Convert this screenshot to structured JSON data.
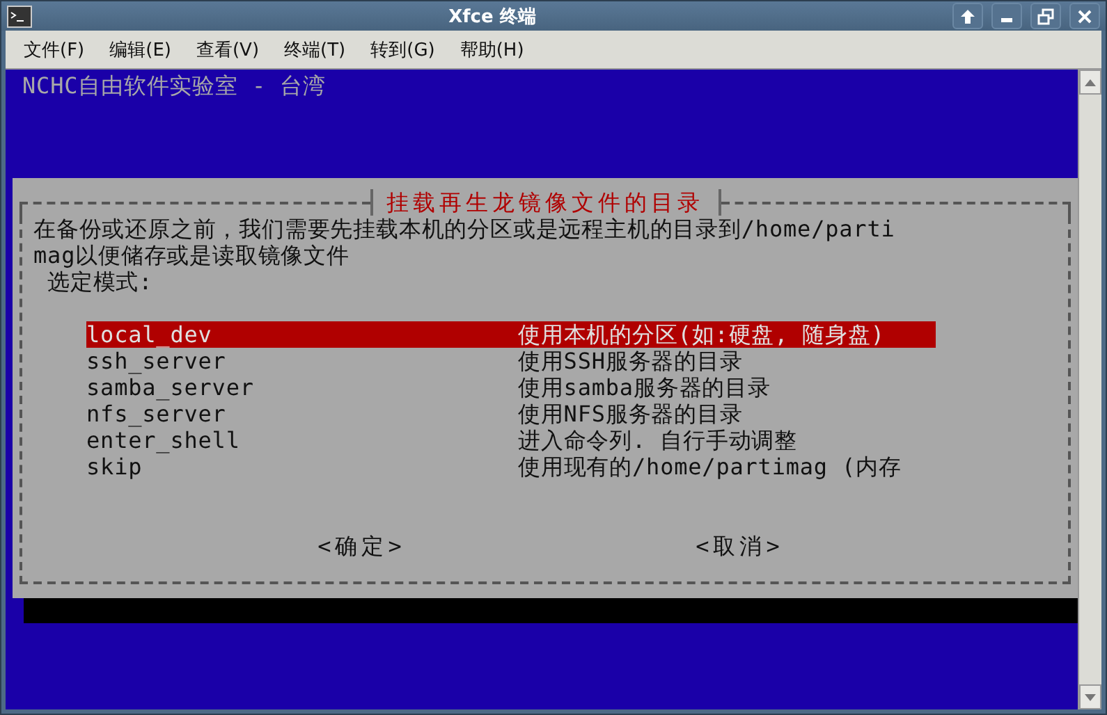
{
  "window": {
    "title": "Xfce 终端"
  },
  "menu": [
    "文件(F)",
    "编辑(E)",
    "查看(V)",
    "终端(T)",
    "转到(G)",
    "帮助(H)"
  ],
  "terminal": {
    "header": "NCHC自由软件实验室 - 台湾"
  },
  "dialog": {
    "title": "挂载再生龙镜像文件的目录",
    "message_lines": [
      "在备份或还原之前，我们需要先挂载本机的分区或是远程主机的目录到/home/parti",
      "mag以便储存或是读取镜像文件"
    ],
    "prompt": "选定模式:",
    "items": [
      {
        "tag": "local_dev",
        "description": "使用本机的分区(如:硬盘, 随身盘)",
        "selected": true
      },
      {
        "tag": "ssh_server",
        "description": "使用SSH服务器的目录",
        "selected": false
      },
      {
        "tag": "samba_server",
        "description": "使用samba服务器的目录",
        "selected": false
      },
      {
        "tag": "nfs_server",
        "description": "使用NFS服务器的目录",
        "selected": false
      },
      {
        "tag": "enter_shell",
        "description": "进入命令列. 自行手动调整",
        "selected": false
      },
      {
        "tag": "skip",
        "description": "使用现有的/home/partimag (内存",
        "selected": false
      }
    ],
    "buttons": [
      "<确定>",
      "<取消>"
    ]
  }
}
